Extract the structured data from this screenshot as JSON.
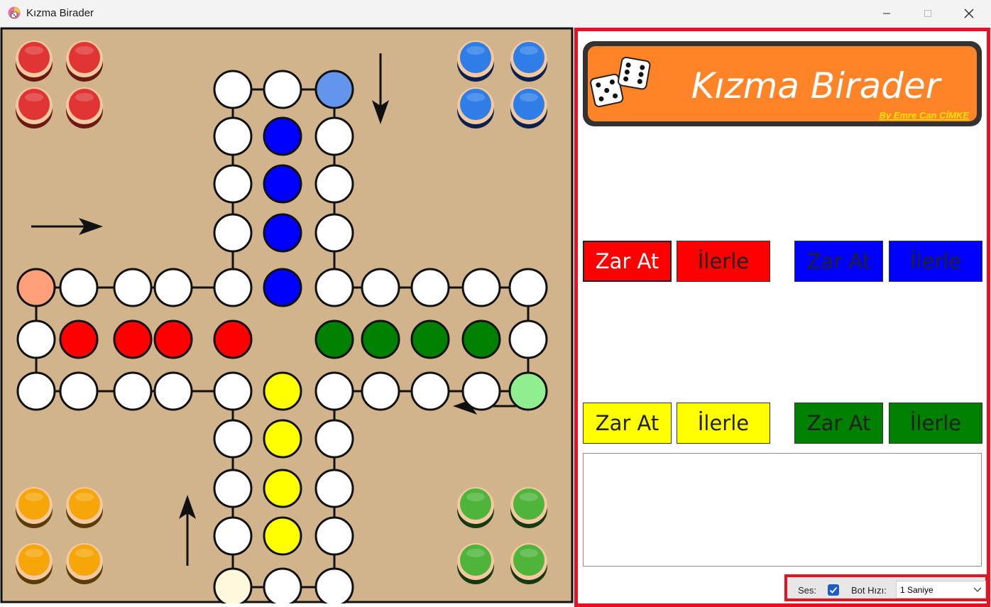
{
  "window": {
    "title": "Kızma Birader"
  },
  "logo": {
    "title": "Kızma Birader",
    "byline": "By Emre Can ÇİMKE"
  },
  "controls": {
    "red": {
      "roll": "Zar At",
      "advance": "İlerle"
    },
    "blue": {
      "roll": "Zar At",
      "advance": "İlerle"
    },
    "yellow": {
      "roll": "Zar At",
      "advance": "İlerle"
    },
    "green": {
      "roll": "Zar At",
      "advance": "İlerle"
    }
  },
  "settings": {
    "sound_label": "Ses:",
    "sound_checked": true,
    "bot_speed_label": "Bot Hızı:",
    "bot_speed_value": "1 Saniye"
  },
  "log": {
    "text": ""
  },
  "colors": {
    "board": "#d2b48c",
    "red": "#ff0000",
    "blue": "#0000ff",
    "yellow": "#ffff00",
    "green": "#008000",
    "red_start": "#ffa07a",
    "blue_start": "#6495ed",
    "yellow_start": "#fff8dc",
    "green_start": "#90ee90",
    "logo_bg": "#ff8427",
    "panel_border": "#e81123"
  },
  "icons": [
    "app-icon",
    "minimize-icon",
    "maximize-icon",
    "close-icon",
    "dice-icon",
    "arrow-icon",
    "checkbox-check-icon",
    "chevron-down-icon"
  ]
}
